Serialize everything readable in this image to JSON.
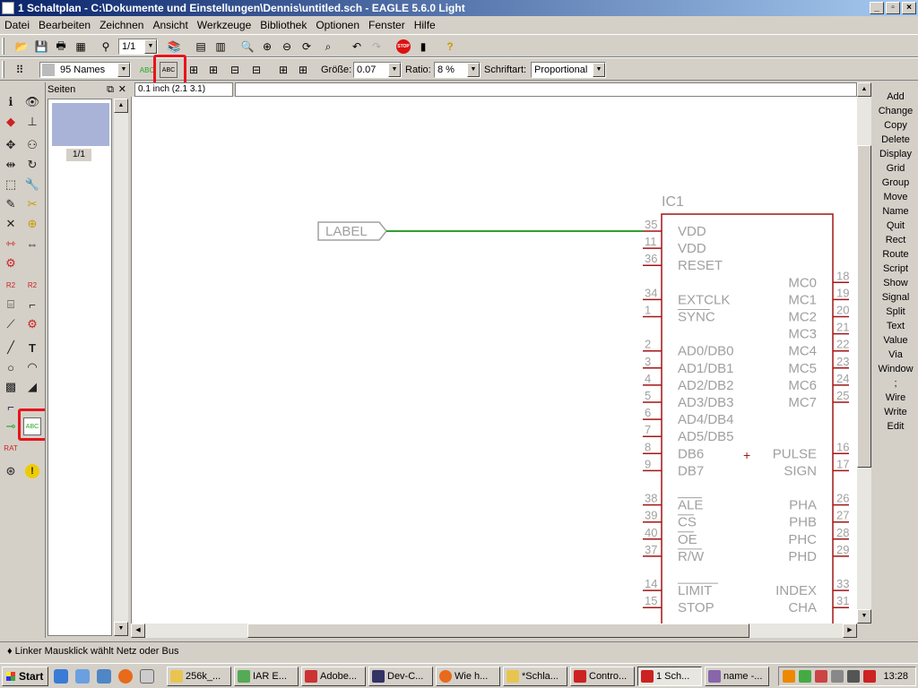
{
  "window": {
    "title": "1 Schaltplan - C:\\Dokumente und Einstellungen\\Dennis\\untitled.sch - EAGLE 5.6.0 Light"
  },
  "menu": [
    "Datei",
    "Bearbeiten",
    "Zeichnen",
    "Ansicht",
    "Werkzeuge",
    "Bibliothek",
    "Optionen",
    "Fenster",
    "Hilfe"
  ],
  "toolbar": {
    "sheet_select": "1/1"
  },
  "parambar": {
    "layer": "95 Names",
    "size_label": "Größe:",
    "size_value": "0.07",
    "ratio_label": "Ratio:",
    "ratio_value": "8 %",
    "font_label": "Schriftart:",
    "font_value": "Proportional"
  },
  "pages_panel": {
    "title": "Seiten",
    "page_label": "1/1"
  },
  "coord": "0.1 inch (2.1 3.1)",
  "commands": [
    "Add",
    "Change",
    "Copy",
    "Delete",
    "Display",
    "Grid",
    "Group",
    "Move",
    "Name",
    "Quit",
    "Rect",
    "Route",
    "Script",
    "Show",
    "Signal",
    "Split",
    "Text",
    "Value",
    "Via",
    "Window",
    ";",
    "Wire",
    "Write",
    "Edit"
  ],
  "schematic": {
    "label": "LABEL",
    "part_name": "IC1",
    "left_pins": [
      {
        "num": "35",
        "name": "VDD"
      },
      {
        "num": "11",
        "name": "VDD"
      },
      {
        "num": "36",
        "name": "RESET"
      },
      {
        "num": "34",
        "name": "EXTCLK"
      },
      {
        "num": "1",
        "name": "SYNC"
      },
      {
        "num": "2",
        "name": "AD0/DB0"
      },
      {
        "num": "3",
        "name": "AD1/DB1"
      },
      {
        "num": "4",
        "name": "AD2/DB2"
      },
      {
        "num": "5",
        "name": "AD3/DB3"
      },
      {
        "num": "6",
        "name": "AD4/DB4"
      },
      {
        "num": "7",
        "name": "AD5/DB5"
      },
      {
        "num": "8",
        "name": "DB6"
      },
      {
        "num": "9",
        "name": "DB7"
      },
      {
        "num": "38",
        "name": "ALE"
      },
      {
        "num": "39",
        "name": "CS"
      },
      {
        "num": "40",
        "name": "OE"
      },
      {
        "num": "37",
        "name": "R/W"
      },
      {
        "num": "14",
        "name": "LIMIT"
      },
      {
        "num": "15",
        "name": "STOP"
      }
    ],
    "right_pins": [
      {
        "num": "18",
        "name": "MC0"
      },
      {
        "num": "19",
        "name": "MC1"
      },
      {
        "num": "20",
        "name": "MC2"
      },
      {
        "num": "21",
        "name": "MC3"
      },
      {
        "num": "22",
        "name": "MC4"
      },
      {
        "num": "23",
        "name": "MC5"
      },
      {
        "num": "24",
        "name": "MC6"
      },
      {
        "num": "25",
        "name": "MC7"
      },
      {
        "num": "16",
        "name": "PULSE"
      },
      {
        "num": "17",
        "name": "SIGN"
      },
      {
        "num": "26",
        "name": "PHA"
      },
      {
        "num": "27",
        "name": "PHB"
      },
      {
        "num": "28",
        "name": "PHC"
      },
      {
        "num": "29",
        "name": "PHD"
      },
      {
        "num": "33",
        "name": "INDEX"
      },
      {
        "num": "31",
        "name": "CHA"
      }
    ],
    "origin_mark": "+"
  },
  "status": "♦ Linker Mausklick wählt Netz oder Bus",
  "taskbar": {
    "start": "Start",
    "items": [
      "256k_...",
      "IAR E...",
      "Adobe...",
      "Dev-C...",
      "Wie h...",
      "*Schla...",
      "Contro...",
      "1 Sch...",
      "name -..."
    ],
    "clock": "13:28"
  },
  "colors": {
    "wire": "#2fa02f",
    "pin": "#a31515",
    "body": "#a31515",
    "text": "#a0a0a0",
    "highlight": "#e8141c"
  }
}
